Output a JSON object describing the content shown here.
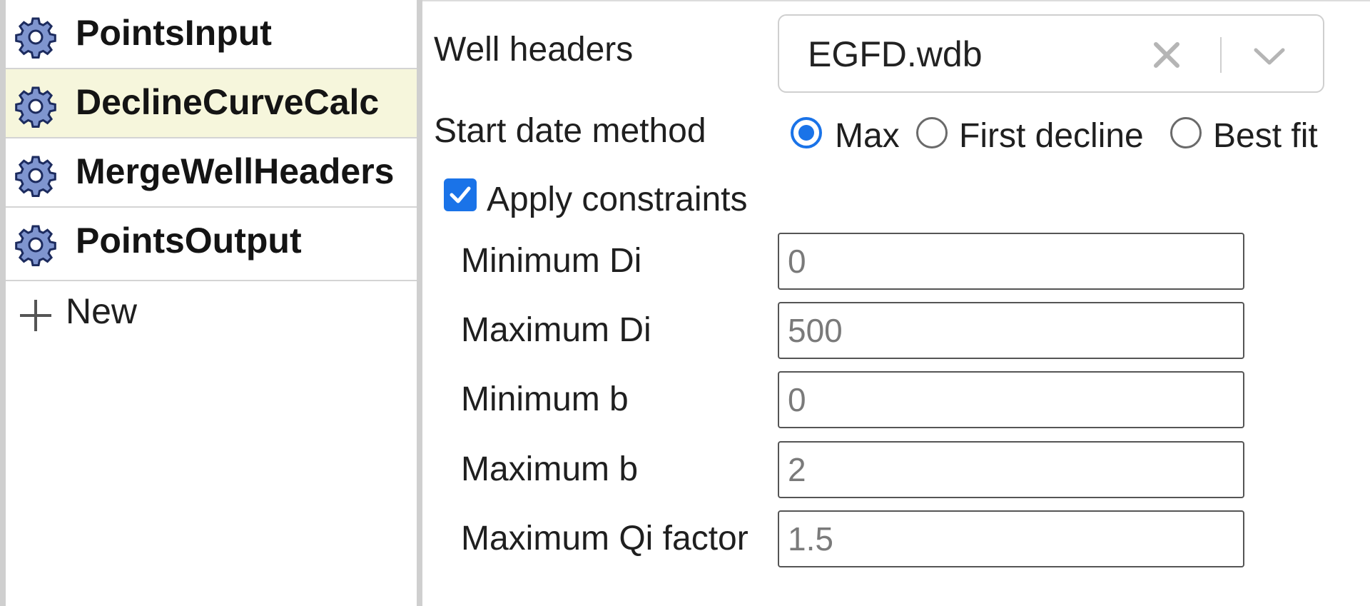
{
  "sidebar": {
    "items": [
      {
        "label": "PointsInput",
        "icon": "gear-icon",
        "selected": false
      },
      {
        "label": "DeclineCurveCalc",
        "icon": "gear-icon",
        "selected": true
      },
      {
        "label": "MergeWellHeaders",
        "icon": "gear-icon",
        "selected": false
      },
      {
        "label": "PointsOutput",
        "icon": "gear-icon",
        "selected": false
      }
    ],
    "new_label": "New",
    "new_icon": "plus-icon",
    "selected_bg": "#f6f6dc"
  },
  "form": {
    "well_headers": {
      "label": "Well headers",
      "value": "EGFD.wdb"
    },
    "start_date_method": {
      "label": "Start date method",
      "options": [
        "Max",
        "First decline",
        "Best fit"
      ],
      "selected": "Max"
    },
    "apply_constraints": {
      "label": "Apply constraints",
      "checked": true
    },
    "fields": [
      {
        "label": "Minimum Di",
        "value": "0"
      },
      {
        "label": "Maximum Di",
        "value": "500"
      },
      {
        "label": "Minimum b",
        "value": "0"
      },
      {
        "label": "Maximum b",
        "value": "2"
      },
      {
        "label": "Maximum Qi factor",
        "value": "1.5"
      }
    ]
  },
  "colors": {
    "accent": "#1a73e8",
    "gear_fill": "#7f95cf",
    "gear_stroke": "#1c2b5e"
  }
}
